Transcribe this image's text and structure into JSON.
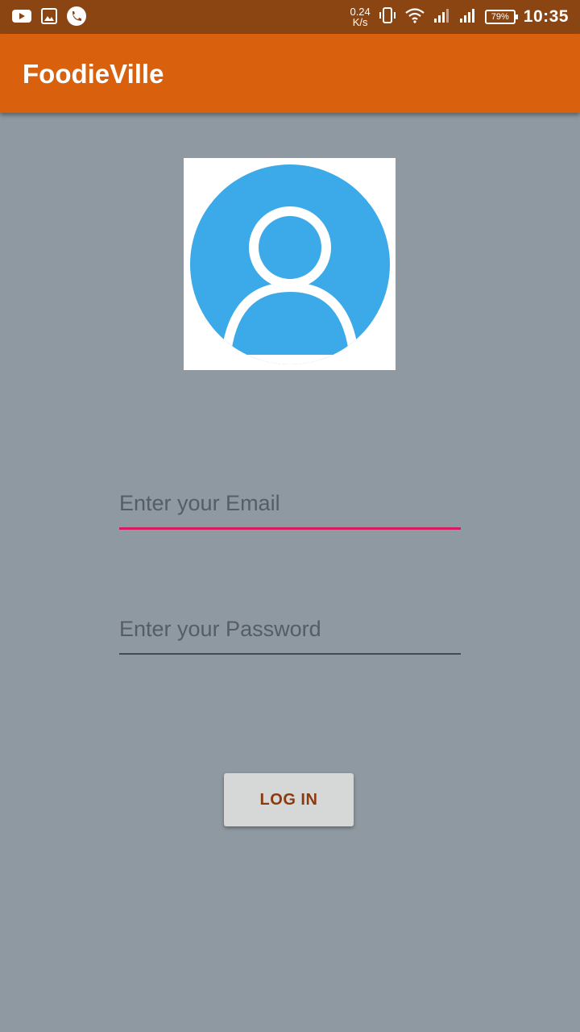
{
  "status_bar": {
    "net_speed_value": "0.24",
    "net_speed_unit": "K/s",
    "battery_percent": "79%",
    "time": "10:35",
    "icons": [
      "youtube-icon",
      "gallery-icon",
      "phone-icon",
      "vibrate-icon",
      "wifi-icon",
      "signal-icon",
      "signal-icon",
      "battery-icon"
    ]
  },
  "app_bar": {
    "title": "FoodieVille",
    "color": "#d9600c"
  },
  "avatar": {
    "icon": "user-avatar-icon",
    "color": "#3ca9e8"
  },
  "form": {
    "email_placeholder": "Enter your Email",
    "email_value": "",
    "password_placeholder": "Enter your Password",
    "password_value": "",
    "accent_color": "#d81b60",
    "login_label": "LOG IN"
  },
  "colors": {
    "background": "#8f99a1",
    "status_bar": "#8b4513",
    "button_text": "#8b3a0f"
  }
}
